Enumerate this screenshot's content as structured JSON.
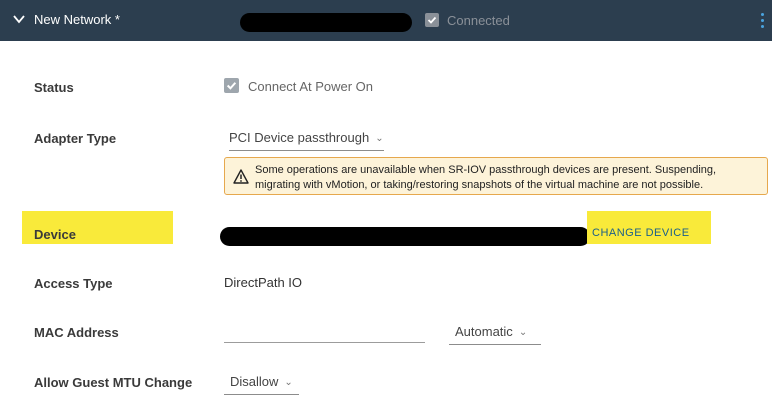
{
  "header": {
    "title": "New Network *",
    "connected_label": "Connected"
  },
  "rows": {
    "status": {
      "label": "Status",
      "checkbox_label": "Connect At Power On",
      "checked": true
    },
    "adapter": {
      "label": "Adapter Type",
      "value": "PCI Device passthrough",
      "warning": "Some operations are unavailable when SR-IOV passthrough devices are present. Suspending, migrating with vMotion, or taking/restoring snapshots of the virtual machine are not possible."
    },
    "device": {
      "label": "Device",
      "button": "CHANGE DEVICE"
    },
    "access": {
      "label": "Access Type",
      "value": "DirectPath IO"
    },
    "mac": {
      "label": "MAC Address",
      "value": "",
      "mode": "Automatic"
    },
    "mtu": {
      "label": "Allow Guest MTU Change",
      "value": "Disallow"
    }
  },
  "colors": {
    "header_bg": "#2c3e4f",
    "highlight": "#f9ea3a",
    "warning_bg": "#fdf3d9",
    "warning_border": "#e6a84d",
    "link": "#1a5f8a"
  }
}
